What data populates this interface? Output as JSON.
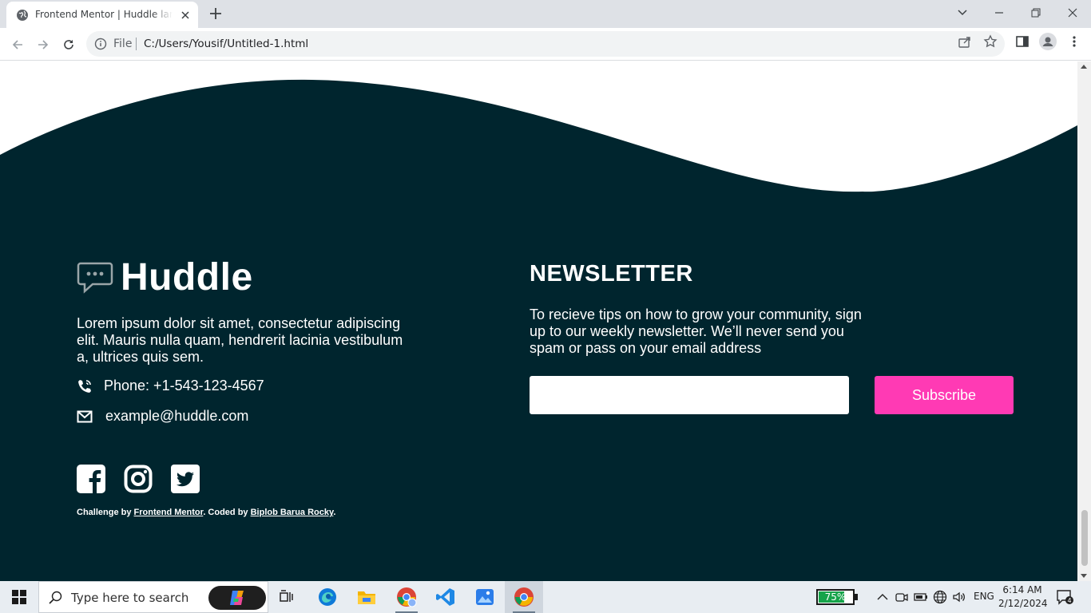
{
  "browser": {
    "tab_title": "Frontend Mentor | Huddle landing page",
    "url_scheme": "File",
    "url": "C:/Users/Yousif/Untitled-1.html"
  },
  "page": {
    "logo_text": "Huddle",
    "about": "Lorem ipsum dolor sit amet, consectetur adipiscing elit. Mauris nulla quam, hendrerit lacinia vestibulum a, ultrices quis sem.",
    "phone": "Phone: +1-543-123-4567",
    "email": "example@huddle.com",
    "socials": [
      "facebook-icon",
      "instagram-icon",
      "twitter-icon"
    ],
    "credit": {
      "prefix": "Challenge by ",
      "link1": "Frontend Mentor",
      "middle": ". Coded by ",
      "link2": "Biplob Barua Rocky",
      "suffix": "."
    },
    "newsletter": {
      "title": "NEWSLETTER",
      "description": "To recieve tips on how to grow your community, sign up to our weekly newsletter. We’ll never send you spam or pass on your email address",
      "input_value": "",
      "button": "Subscribe"
    },
    "colors": {
      "background": "#00252e",
      "accent": "#ff3ab4",
      "text": "#ffffff"
    }
  },
  "taskbar": {
    "search_placeholder": "Type here to search",
    "battery": "75%",
    "battery_level": 0.75,
    "language": "ENG",
    "time": "6:14 AM",
    "date": "2/12/2024",
    "notification_count": "4"
  }
}
